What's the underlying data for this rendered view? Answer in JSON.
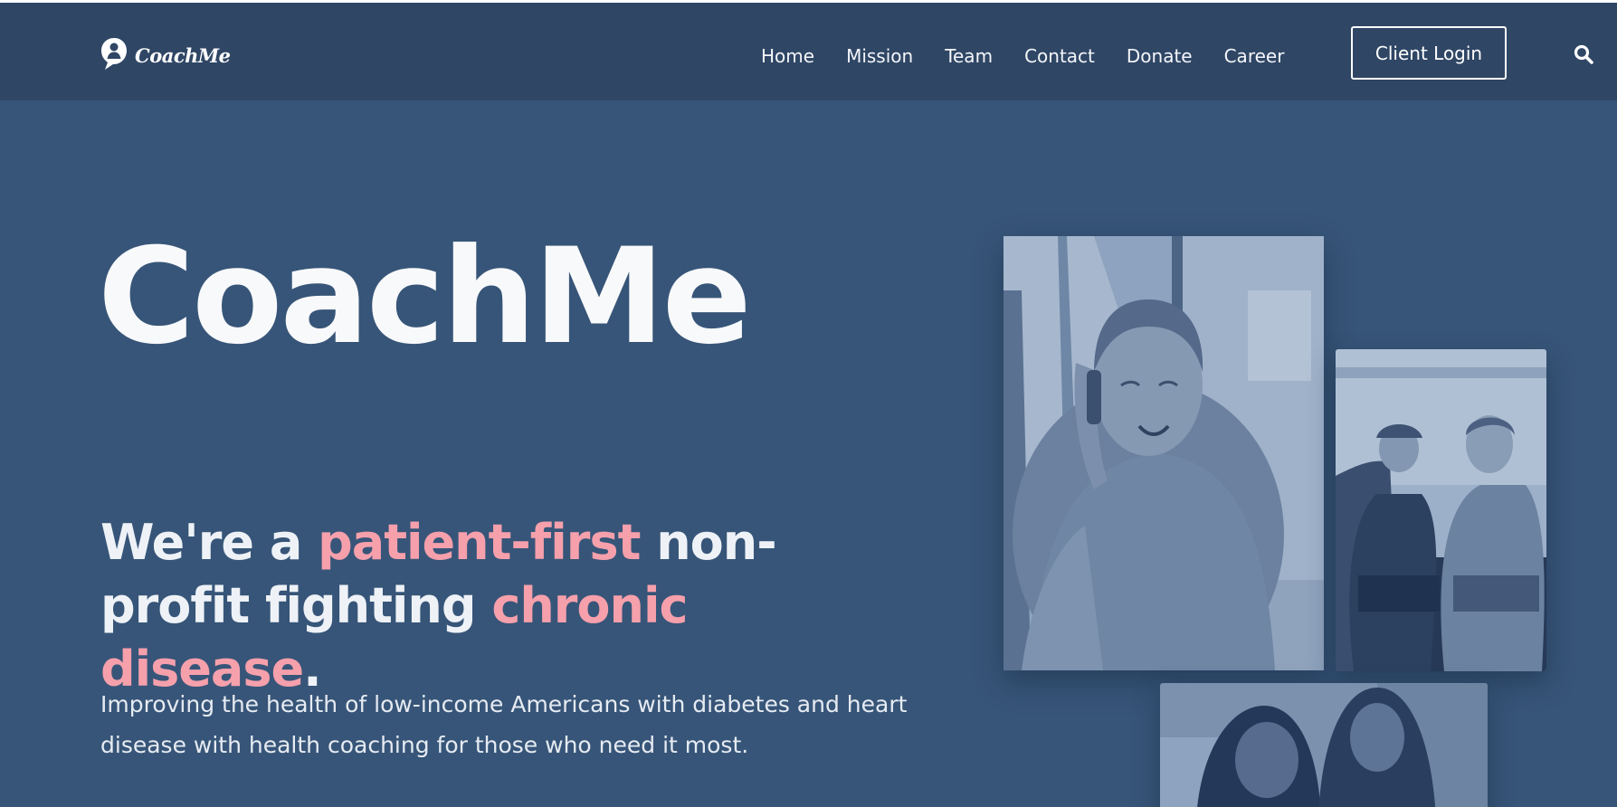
{
  "nav": {
    "brand_name": "CoachMe",
    "links": [
      "Home",
      "Mission",
      "Team",
      "Contact",
      "Donate",
      "Career"
    ],
    "login_label": "Client Login",
    "search_icon": "search-icon"
  },
  "hero": {
    "title": "CoachMe",
    "tagline": {
      "part1": "We're a ",
      "accent1": "patient-first",
      "part2": " non-profit fighting ",
      "accent2": "chronic disease",
      "part3": "."
    },
    "subtext": "Improving the health of low-income Americans with diabetes and heart disease with health coaching for those who need it most."
  },
  "colors": {
    "navbar": "#2f4665",
    "hero_background": "#375578",
    "accent_pink": "#f6a0ac",
    "text_light": "#f8f9fb"
  }
}
